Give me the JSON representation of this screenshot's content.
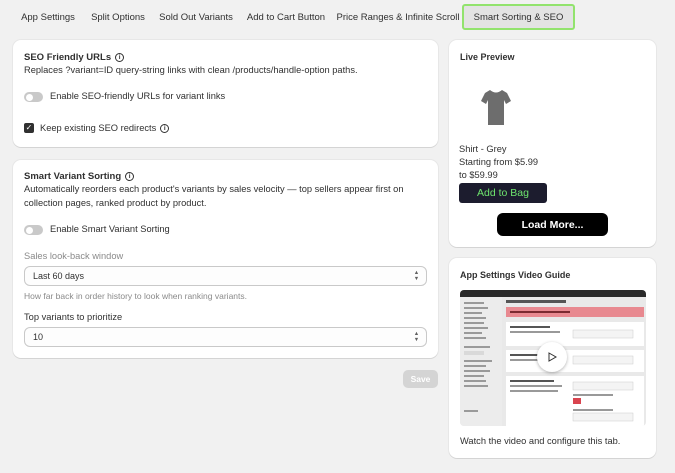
{
  "tabs": [
    {
      "label": "App Settings"
    },
    {
      "label": "Split Options"
    },
    {
      "label": "Sold Out Variants"
    },
    {
      "label": "Add to Cart Button"
    },
    {
      "label": "Price Ranges & Infinite Scroll"
    },
    {
      "label": "Smart Sorting & SEO",
      "active": true
    }
  ],
  "seo": {
    "title": "SEO Friendly URLs",
    "description": "Replaces ?variant=ID query-string links with clean /products/handle-option paths.",
    "toggle_label": "Enable SEO-friendly URLs for variant links",
    "toggle_on": false,
    "checkbox_label": "Keep existing SEO redirects",
    "checkbox_checked": true
  },
  "sorting": {
    "title": "Smart Variant Sorting",
    "description_line1": "Automatically reorders each product's variants by sales velocity — top sellers appear first on",
    "description_line2": "collection pages, ranked product by product.",
    "toggle_label": "Enable Smart Variant Sorting",
    "toggle_on": false,
    "lookback_label": "Sales look-back window",
    "lookback_value": "Last 60 days",
    "lookback_help": "How far back in order history to look when ranking variants.",
    "top_label": "Top variants to prioritize",
    "top_value": "10"
  },
  "save_label": "Save",
  "preview": {
    "title": "Live Preview",
    "product_name": "Shirt - Grey",
    "price_line1": "Starting from $5.99",
    "price_line2": "to $59.99",
    "add_button": "Add to Bag",
    "load_more": "Load More..."
  },
  "video_guide": {
    "title": "App Settings Video Guide",
    "caption": "Watch the video and configure this tab."
  },
  "colors": {
    "active_tab_border": "#92e36d",
    "add_button_bg": "#1c1c2e",
    "add_button_text": "#6ee56e",
    "load_more_bg": "#000000"
  }
}
